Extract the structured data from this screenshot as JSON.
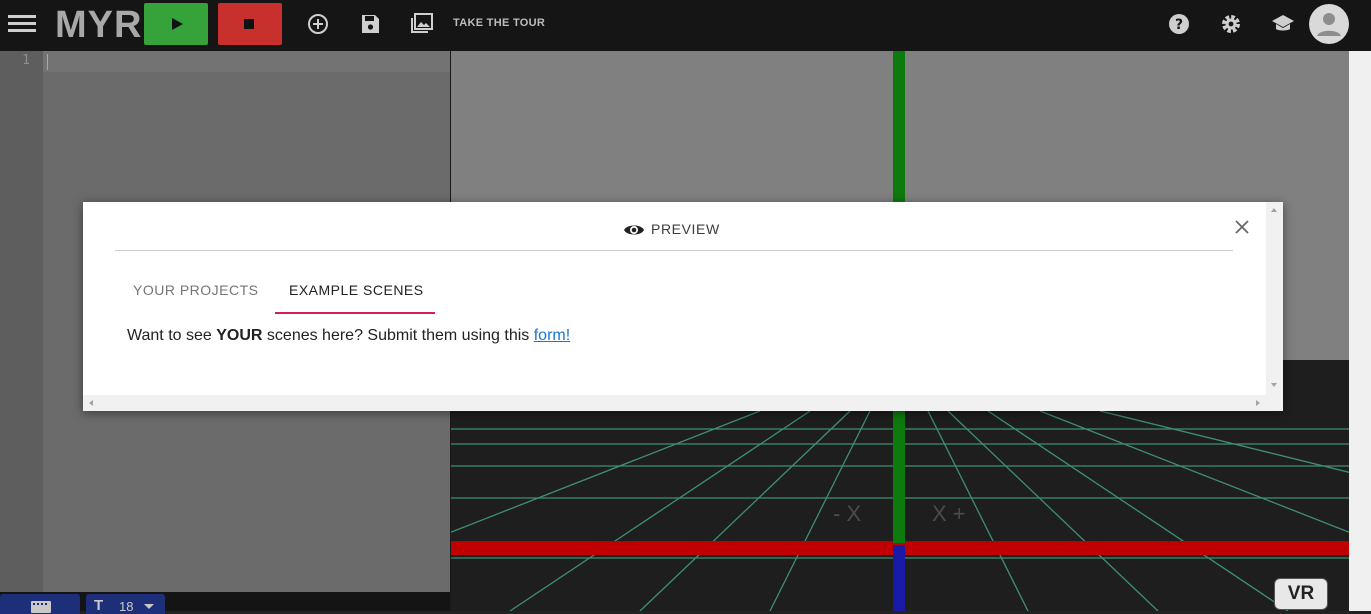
{
  "app": {
    "logo": "MYR",
    "tour_label": "TAKE THE TOUR",
    "accent": {
      "run": "#36a33a",
      "stop": "#c8302e",
      "tab_indicator": "#d81b60",
      "link": "#1976d2"
    }
  },
  "toolbar": {
    "icons": [
      "menu-icon",
      "play-icon",
      "stop-icon",
      "add-circle-icon",
      "save-icon",
      "collections-icon"
    ]
  },
  "header_right": {
    "icons": [
      "help-icon",
      "gear-icon",
      "school-icon",
      "avatar-icon"
    ]
  },
  "editor": {
    "line_numbers": [
      "1"
    ],
    "font_size": "18"
  },
  "scene": {
    "axis_minus": "- X",
    "axis_plus": "X +",
    "vr_label": "VR"
  },
  "modal": {
    "title": "PREVIEW",
    "tabs": [
      {
        "label": "YOUR PROJECTS",
        "active": false
      },
      {
        "label": "EXAMPLE SCENES",
        "active": true
      }
    ],
    "message": {
      "prefix": "Want to see ",
      "bold": "YOUR",
      "middle": " scenes here? Submit them using this ",
      "link": "form!"
    }
  }
}
